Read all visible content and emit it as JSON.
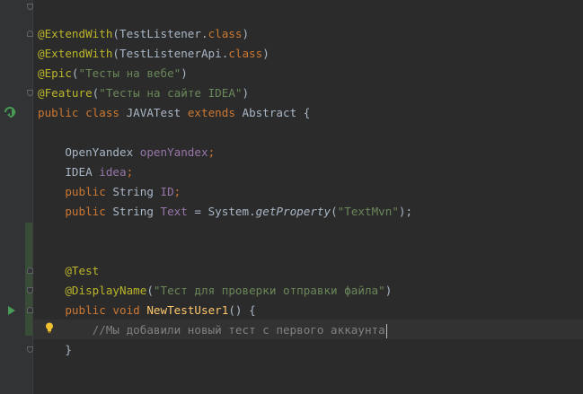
{
  "editor": {
    "lines": {
      "l1_a": "@ExtendWith",
      "l1_b": "(TestListener.",
      "l1_c": "class",
      "l1_d": ")",
      "l2_a": "@ExtendWith",
      "l2_b": "(TestListenerApi.",
      "l2_c": "class",
      "l2_d": ")",
      "l3_a": "@Epic",
      "l3_b": "(",
      "l3_c": "\"Тесты на вебе\"",
      "l3_d": ")",
      "l4_a": "@Feature",
      "l4_b": "(",
      "l4_c": "\"Тесты на сайте IDEA\"",
      "l4_d": ")",
      "l5_kw1": "public class ",
      "l5_name": "JAVATest ",
      "l5_kw2": "extends ",
      "l5_base": "Abstract {",
      "l6_type": "    OpenYandex ",
      "l6_field": "openYandex",
      "l6_semi": ";",
      "l7_type": "    IDEA ",
      "l7_field": "idea",
      "l7_semi": ";",
      "l8_kw": "    public ",
      "l8_type": "String ",
      "l8_field": "ID",
      "l8_semi": ";",
      "l9_kw": "    public ",
      "l9_type": "String ",
      "l9_field": "Text",
      "l9_eq": " = System.",
      "l9_call": "getProperty",
      "l9_open": "(",
      "l9_str": "\"TextMvn\"",
      "l9_close": ");",
      "l10_ann": "    @Test",
      "l11_ann": "    @DisplayName",
      "l11_open": "(",
      "l11_str": "\"Тест для проверки отправки файла\"",
      "l11_close": ")",
      "l12_kw": "    public void ",
      "l12_mth": "NewTestUser1",
      "l12_rest": "() {",
      "l13_cmt": "        //Мы добавили новый тест с первого аккаунта",
      "l14_brace": "    }"
    }
  },
  "icons": {
    "run_class": "run-test-class-icon",
    "run_method": "run-test-method-icon",
    "intention": "lightbulb-icon",
    "fold": "fold-marker-icon"
  },
  "colors": {
    "background": "#2b2b2b",
    "annotation": "#bbb529",
    "string": "#6a8759",
    "keyword": "#cc7832",
    "field": "#9876aa",
    "method": "#ffc66d",
    "comment": "#808080",
    "text": "#a9b7c6"
  }
}
